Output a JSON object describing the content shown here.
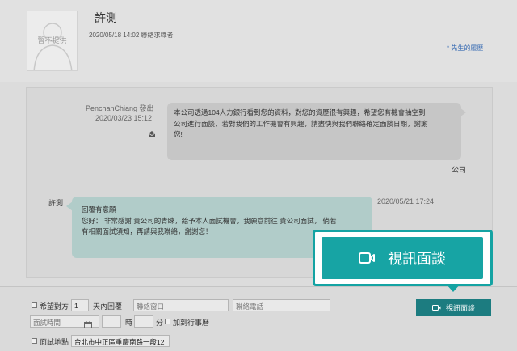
{
  "header": {
    "avatar_text": "暫不提供",
    "name": "許測",
    "meta": "2020/05/18 14:02 聯絡求職者",
    "resume_link": "* 先生的履歷"
  },
  "conversation": {
    "outgoing": {
      "sender": "PenchanChiang 發出",
      "time": "2020/03/23 15:12",
      "lines": [
        "本公司透過104人力銀行看到您的資料，對您的資歷很有興趣，希望您有機會抽空到",
        "公司進行面談，若對我們的工作機會有興趣，請盡快與我們聯絡確定面談日期，謝謝",
        "您!"
      ],
      "label": "公司"
    },
    "incoming": {
      "sender": "許測",
      "time": "2020/05/21 17:24",
      "lines": [
        "回覆有意願",
        "您好：  非常感謝 貴公司的青睞，給予本人面試機會，我願意前往 貴公司面試，  倘若",
        "有相關面試須知，再請與我聯絡，謝謝您！"
      ]
    }
  },
  "form": {
    "expect_reply_label": "希望對方",
    "days_value": "1",
    "days_suffix": "天內回覆",
    "contact_window_placeholder": "聯絡窗口",
    "contact_phone_placeholder": "聯絡電話",
    "interview_time_placeholder": "面試時間",
    "hour_label": "時",
    "minute_label": "分",
    "add_calendar_label": "加到行事曆",
    "location_label": "面試地點",
    "location_value": "台北市中正區重慶南路一段12",
    "video_button_label": "視訊面談"
  },
  "highlight": {
    "label": "視訊面談"
  },
  "colors": {
    "accent": "#17a4a4",
    "accent_dark": "#1c7c80",
    "incoming_bubble": "#b1ccc9",
    "outgoing_bubble": "#c6c6c6",
    "link": "#3c6eb4"
  },
  "icons": {
    "avatar": "person-silhouette-icon",
    "read_receipt": "envelope-open-icon",
    "calendar": "calendar-icon",
    "video": "video-camera-icon"
  }
}
